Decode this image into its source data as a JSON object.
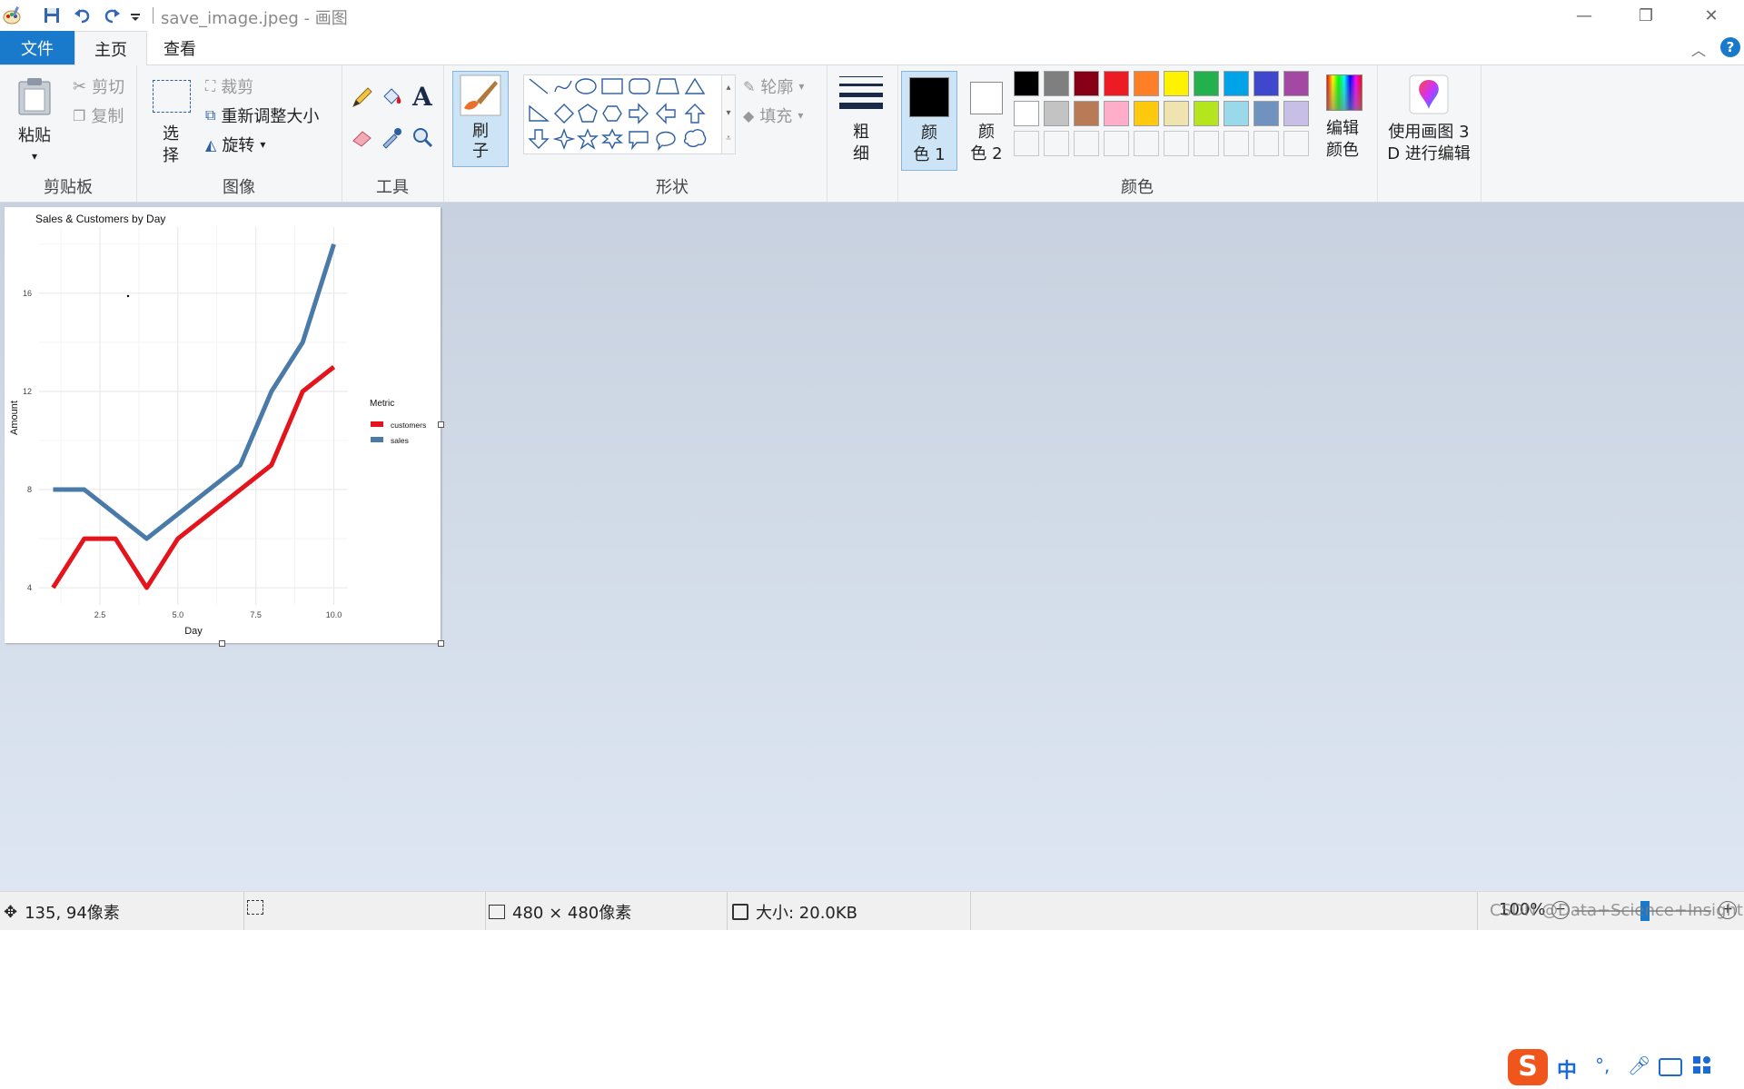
{
  "window": {
    "title": "save_image.jpeg - 画图",
    "minimize": "—",
    "restore": "❐",
    "close": "✕"
  },
  "tabs": {
    "file": "文件",
    "home": "主页",
    "view": "查看"
  },
  "ribbon": {
    "clipboard": {
      "label": "剪贴板",
      "paste": "粘贴",
      "cut": "剪切",
      "copy": "复制"
    },
    "image": {
      "label": "图像",
      "select_1": "选",
      "select_2": "择",
      "crop": "裁剪",
      "resize": "重新调整大小",
      "rotate": "旋转"
    },
    "tools": {
      "label": "工具"
    },
    "brushes": {
      "label_1": "刷",
      "label_2": "子"
    },
    "shapes": {
      "label": "形状",
      "outline": "轮廓",
      "fill": "填充"
    },
    "size": {
      "label_1": "粗",
      "label_2": "细"
    },
    "colors": {
      "label": "颜色",
      "color1_1": "颜",
      "color1_2": "色 1",
      "color2_1": "颜",
      "color2_2": "色 2",
      "edit_1": "编辑",
      "edit_2": "颜色",
      "color1_value": "#000000",
      "color2_value": "#ffffff",
      "palette_row1": [
        "#000000",
        "#7f7f7f",
        "#880015",
        "#ed1c24",
        "#ff7f27",
        "#fff200",
        "#22b14c",
        "#00a2e8",
        "#3f48cc",
        "#a349a4"
      ],
      "palette_row2": [
        "#ffffff",
        "#c3c3c3",
        "#b97a57",
        "#ffaec9",
        "#ffc90e",
        "#efe4b0",
        "#b5e61d",
        "#99d9ea",
        "#7092be",
        "#c8bfe7"
      ]
    },
    "paint3d": {
      "line1": "使用画图 3",
      "line2": "D 进行编辑"
    }
  },
  "statusbar": {
    "cursor_pos": "135, 94像素",
    "canvas_size": "480 × 480像素",
    "file_size": "大小: 20.0KB",
    "zoom": "100%",
    "watermark": "CSDN @Data+Science+Insight"
  },
  "ime": {
    "lang": "中",
    "punct": "°,"
  },
  "chart_data": {
    "type": "line",
    "title": "Sales & Customers by Day",
    "xlabel": "Day",
    "ylabel": "Amount",
    "x": [
      1,
      2,
      3,
      4,
      5,
      6,
      7,
      8,
      9,
      10
    ],
    "xlim": [
      0.55,
      10.45
    ],
    "ylim": [
      3.3,
      18.7
    ],
    "xticks": [
      "2.5",
      "5.0",
      "7.5",
      "10.0"
    ],
    "xtick_values": [
      2.5,
      5.0,
      7.5,
      10.0
    ],
    "yticks": [
      "4",
      "8",
      "12",
      "16"
    ],
    "ytick_values": [
      4,
      8,
      12,
      16
    ],
    "legend_title": "Metric",
    "legend_position": "right",
    "grid": true,
    "series": [
      {
        "name": "customers",
        "color": "#e3141b",
        "values": [
          4,
          6,
          6,
          4,
          6,
          7,
          8,
          9,
          12,
          13
        ]
      },
      {
        "name": "sales",
        "color": "#4a7aa7",
        "values": [
          8,
          8,
          7,
          6,
          7,
          8,
          9,
          12,
          14,
          18
        ]
      }
    ]
  }
}
